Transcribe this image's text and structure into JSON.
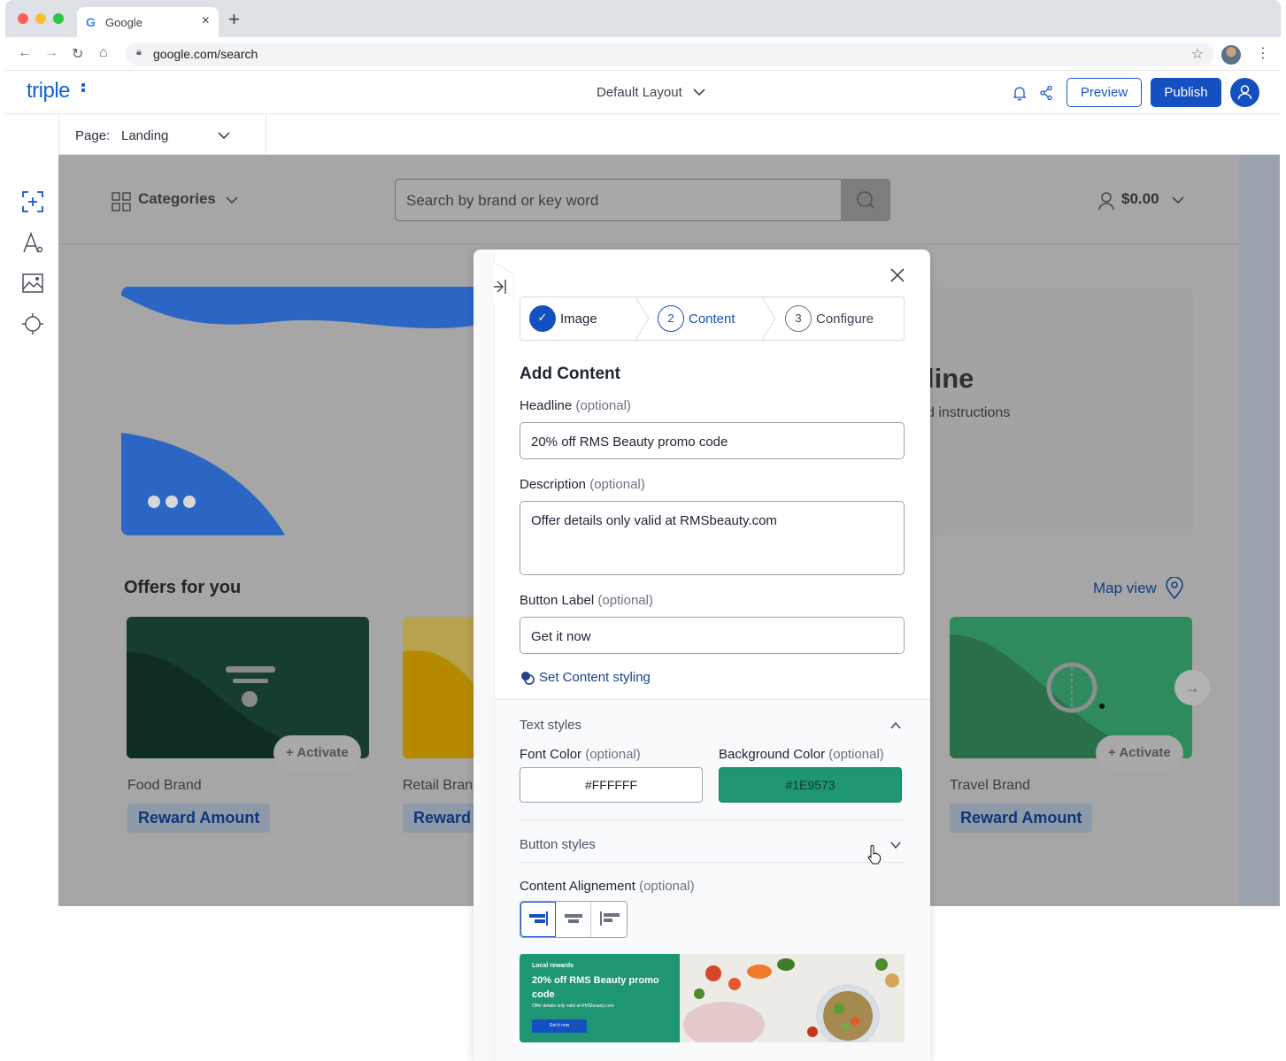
{
  "browser": {
    "tab_title": "Google",
    "url": "google.com/search"
  },
  "app": {
    "logo": "triple",
    "layout_selector": "Default Layout",
    "preview_label": "Preview",
    "publish_label": "Publish",
    "accent": "#1550C1"
  },
  "pagebar": {
    "label": "Page:",
    "value": "Landing"
  },
  "sidebar_tools": [
    "add-block-icon",
    "typography-icon",
    "image-icon",
    "theme-icon"
  ],
  "site": {
    "categories": "Categories",
    "search_placeholder": "Search by brand or key word",
    "balance": "$0.00",
    "hero_headline": "line",
    "hero_sub": "d instructions",
    "offers_title": "Offers for you",
    "map_view": "Map view",
    "cards": [
      {
        "brand": "Food Brand",
        "reward": "Reward Amount",
        "activate": "Activate"
      },
      {
        "brand": "Retail Bran",
        "reward": "Reward"
      },
      {
        "brand": "Travel Brand",
        "reward": "Reward Amount",
        "activate": "Activate"
      }
    ]
  },
  "modal": {
    "steps": [
      {
        "num": "✓",
        "label": "Image",
        "state": "done"
      },
      {
        "num": "2",
        "label": "Content",
        "state": "active"
      },
      {
        "num": "3",
        "label": "Configure",
        "state": "todo"
      }
    ],
    "title": "Add Content",
    "headline": {
      "label": "Headline",
      "optional": "(optional)",
      "value": "20% off RMS Beauty promo code"
    },
    "description": {
      "label": "Description",
      "optional": "(optional)",
      "value": "Offer details only valid at RMSbeauty.com"
    },
    "button_label": {
      "label": "Button Label",
      "optional": "(optional)",
      "value": "Get it now"
    },
    "styling_link": "Set Content styling",
    "text_styles": "Text styles",
    "font_color": {
      "label": "Font Color",
      "optional": "(optional)",
      "value": "#FFFFFF"
    },
    "background_color": {
      "label": "Background Color",
      "optional": "(optional)",
      "value": "#1E9573"
    },
    "button_styles": "Button styles",
    "alignment": {
      "label": "Content Alignement",
      "optional": "(optional)"
    },
    "preview": {
      "eyebrow": "Local rewards",
      "headline": "20% off RMS Beauty promo code",
      "description": "Offer details only valid at RMSbeauty.com",
      "button": "Get it now"
    }
  }
}
